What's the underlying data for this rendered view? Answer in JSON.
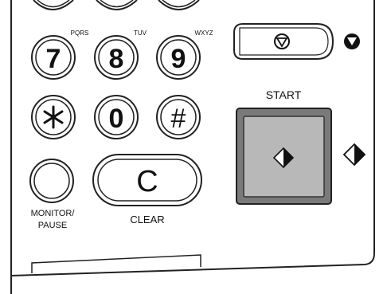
{
  "keypad": {
    "keys": [
      {
        "id": "7",
        "label": "7",
        "sublabel": "PQRS"
      },
      {
        "id": "8",
        "label": "8",
        "sublabel": "TUV"
      },
      {
        "id": "9",
        "label": "9",
        "sublabel": "WXYZ"
      },
      {
        "id": "star",
        "label": "∗",
        "sublabel": ""
      },
      {
        "id": "0",
        "label": "0",
        "sublabel": ""
      },
      {
        "id": "hash",
        "label": "#",
        "sublabel": ""
      }
    ]
  },
  "monitor_pause": {
    "label_line1": "MONITOR/",
    "label_line2": "PAUSE"
  },
  "clear": {
    "key_label": "C",
    "caption": "CLEAR"
  },
  "start": {
    "caption": "START"
  },
  "icons": {
    "stop": "stop-icon",
    "start": "start-icon"
  }
}
